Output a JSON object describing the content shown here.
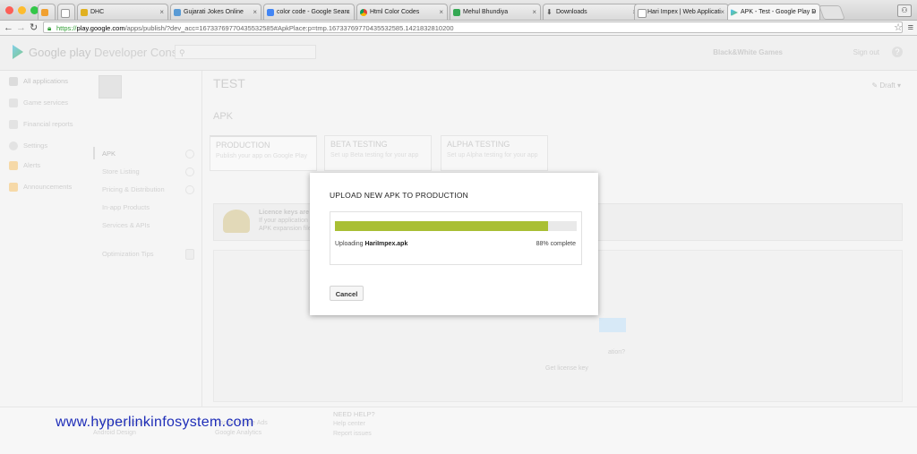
{
  "browser": {
    "tabs": [
      {
        "label": "",
        "icon": "home-favicon"
      },
      {
        "label": "",
        "icon": "blank-page-favicon"
      },
      {
        "label": "DHC",
        "icon": "dhc-favicon"
      },
      {
        "label": "Gujarati Jokes Online",
        "icon": "page-favicon"
      },
      {
        "label": "color code - Google Searc",
        "icon": "google-favicon"
      },
      {
        "label": "Html Color Codes",
        "icon": "chrome-favicon"
      },
      {
        "label": "Mehul Bhundiya",
        "icon": "mehul-favicon"
      },
      {
        "label": "Downloads",
        "icon": "download-favicon"
      },
      {
        "label": "Hari Impex | Web Applicati",
        "icon": "page-favicon"
      },
      {
        "label": "APK - Test - Google Play D",
        "icon": "google-play-favicon"
      }
    ],
    "url_scheme": "https://",
    "url_host": "play.google.com",
    "url_rest": "/apps/publish/?dev_acc=16733769770435532585#ApkPlace:p=tmp.16733769770435532585.1421832810200"
  },
  "console": {
    "brand": "Google play",
    "section": "Developer Console",
    "search_glyph": "⚲",
    "developer_name": "Black&White Games",
    "account_email": "",
    "sign_out": "Sign out",
    "help_glyph": "?",
    "left_nav": [
      {
        "label": "All applications",
        "icon": "android-icon"
      },
      {
        "label": "Game services",
        "icon": "gamepad-icon"
      },
      {
        "label": "Financial reports",
        "icon": "reports-icon"
      },
      {
        "label": "Settings",
        "icon": "gear-icon"
      },
      {
        "label": "Alerts",
        "icon": "alert-icon"
      },
      {
        "label": "Announcements",
        "icon": "announcement-icon"
      }
    ],
    "app_menu": [
      "APK",
      "Store Listing",
      "Pricing & Distribution",
      "In-app Products",
      "Services & APIs",
      "Optimization Tips"
    ],
    "app_title": "TEST",
    "draft_label": "Draft",
    "section_title": "APK",
    "cards": [
      {
        "title": "PRODUCTION",
        "sub": "Publish your app on Google Play"
      },
      {
        "title": "BETA TESTING",
        "sub": "Set up Beta testing for your app"
      },
      {
        "title": "ALPHA TESTING",
        "sub": "Set up Alpha testing for your app"
      }
    ],
    "license_text_1": "Licence keys are",
    "license_text_2": "If your application",
    "license_text_3": "APK expansion files",
    "question_text": "ation?",
    "license_link": "Get license key",
    "footer": {
      "col1": [
        "Android Developers",
        "Android Design"
      ],
      "col2": [
        "Google Mobile Ads",
        "Google Analytics"
      ],
      "help_heading": "NEED HELP?",
      "col3": [
        "Help center",
        "Report issues"
      ]
    }
  },
  "watermark": "www.hyperlinkinfosystem.com",
  "modal": {
    "title": "UPLOAD NEW APK TO PRODUCTION",
    "uploading_prefix": "Uploading",
    "file_name": "HariImpex.apk",
    "progress_percent": 88,
    "progress_text": "88% complete",
    "cancel_label": "Cancel"
  },
  "colors": {
    "progress_fill": "#a9bf34",
    "progress_track": "#e9e9e9",
    "watermark": "#1e2db8",
    "https_green": "#2f9d33"
  }
}
